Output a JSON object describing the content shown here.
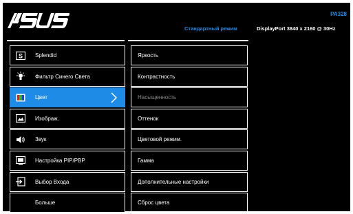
{
  "header": {
    "logo_text": "/ISUS",
    "model": "PA328",
    "mode": "Стандартный режим",
    "connection": "DisplayPort  3840 x 2160 @ 30Hz"
  },
  "menu": [
    {
      "label": "Splendid",
      "icon": "splendid-icon"
    },
    {
      "label": "Фильтр Синего Света",
      "icon": "blue-light-filter-icon"
    },
    {
      "label": "Цвет",
      "icon": "color-icon",
      "active": true
    },
    {
      "label": "Изображ.",
      "icon": "image-icon"
    },
    {
      "label": "Звук",
      "icon": "speaker-icon"
    },
    {
      "label": "Настройка PIP/PBP",
      "icon": "pip-icon"
    },
    {
      "label": "Выбор Входа",
      "icon": "input-select-icon"
    },
    {
      "label": "Больше",
      "icon": ""
    }
  ],
  "submenu": [
    {
      "label": "Яркость"
    },
    {
      "label": "Контрастность"
    },
    {
      "label": "Насыщенность",
      "disabled": true
    },
    {
      "label": "Оттенок"
    },
    {
      "label": "Цветовой режим."
    },
    {
      "label": "Гамма"
    },
    {
      "label": "Дополнительные настройки"
    },
    {
      "label": "Сброс цвета"
    }
  ],
  "colors": {
    "accent": "#1e8be6",
    "background": "#000000",
    "text": "#ffffff",
    "disabled": "#8a8a8a"
  }
}
